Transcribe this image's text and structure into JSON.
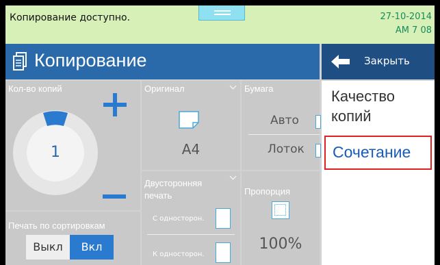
{
  "status": {
    "message": "Копирование доступно.",
    "date": "27-10-2014",
    "time": "AM 7  08"
  },
  "header": {
    "title": "Копирование",
    "close_label": "Закрыть"
  },
  "copies": {
    "label": "Кол-во копий",
    "value": "1"
  },
  "sort": {
    "label": "Печать по сортировкам",
    "off_label": "Выкл",
    "on_label": "Вкл",
    "selected": "Вкл"
  },
  "original": {
    "label": "Оригинал",
    "size": "A4"
  },
  "paper": {
    "label": "Бумага",
    "auto": "Авто",
    "tray": "Лоток"
  },
  "duplex": {
    "label_line1": "Двусторонняя",
    "label_line2": "печать",
    "from_label": "С односторон.",
    "to_label": "К односторон."
  },
  "ratio": {
    "label": "Пропорция",
    "value": "100%"
  },
  "side_menu": {
    "quality_line1": "Качество",
    "quality_line2": "копий",
    "combine": "Сочетание"
  },
  "colors": {
    "accent_blue": "#2a6aaa",
    "button_blue": "#2a7ad0",
    "status_green": "#d6f0b8",
    "highlight_red": "#e02020"
  }
}
